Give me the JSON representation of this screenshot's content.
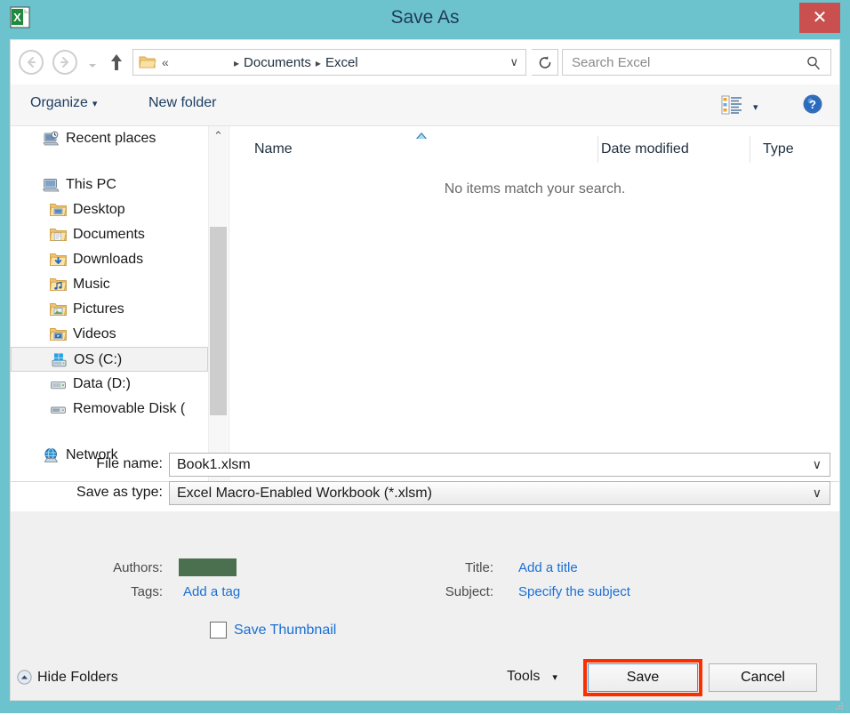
{
  "window": {
    "title": "Save As",
    "app_icon": "excel-icon",
    "close_label": "✕",
    "accent_color": "#6cc3ce",
    "close_color": "#c9504f"
  },
  "navbar": {
    "back_icon": "back-arrow-icon",
    "forward_icon": "forward-arrow-icon",
    "history_icon": "history-dropdown-icon",
    "up_icon": "up-arrow-icon",
    "folder_icon": "folder-icon",
    "overflow": "«",
    "breadcrumb": [
      "Documents",
      "Excel"
    ],
    "breadcrumb_separator": "▸",
    "dropdown_caret": "∨",
    "refresh_icon": "refresh-icon",
    "search_placeholder": "Search Excel",
    "search_value": "",
    "search_icon": "search-icon"
  },
  "toolbar": {
    "organize_label": "Organize",
    "organize_caret": "▾",
    "new_folder_label": "New folder",
    "view_icon": "list-view-icon",
    "view_caret": "▾",
    "help_icon": "help-icon"
  },
  "sidebar": {
    "items": [
      {
        "label": "Recent places",
        "icon": "recent-places-icon",
        "depth": 0,
        "selected": false
      },
      {
        "label": "This PC",
        "icon": "this-pc-icon",
        "depth": 0,
        "selected": false
      },
      {
        "label": "Desktop",
        "icon": "desktop-folder-icon",
        "depth": 1,
        "selected": false
      },
      {
        "label": "Documents",
        "icon": "documents-folder-icon",
        "depth": 1,
        "selected": false
      },
      {
        "label": "Downloads",
        "icon": "downloads-folder-icon",
        "depth": 1,
        "selected": false
      },
      {
        "label": "Music",
        "icon": "music-folder-icon",
        "depth": 1,
        "selected": false
      },
      {
        "label": "Pictures",
        "icon": "pictures-folder-icon",
        "depth": 1,
        "selected": false
      },
      {
        "label": "Videos",
        "icon": "videos-folder-icon",
        "depth": 1,
        "selected": false
      },
      {
        "label": "OS (C:)",
        "icon": "os-drive-icon",
        "depth": 1,
        "selected": true
      },
      {
        "label": "Data (D:)",
        "icon": "drive-icon",
        "depth": 1,
        "selected": false
      },
      {
        "label": "Removable Disk (",
        "icon": "removable-disk-icon",
        "depth": 1,
        "selected": false
      },
      {
        "label": "Network",
        "icon": "network-icon",
        "depth": 0,
        "selected": false
      }
    ],
    "scroll_up": "⌃",
    "scroll_down": "⌄"
  },
  "filelist": {
    "columns": [
      "Name",
      "Date modified",
      "Type"
    ],
    "sort_indicator": "ascending",
    "rows": [],
    "empty_message": "No items match your search.",
    "hscroll_left": "‹",
    "hscroll_right": "›"
  },
  "form": {
    "file_name_label": "File name:",
    "file_name_value": "Book1.xlsm",
    "save_as_type_label": "Save as type:",
    "save_as_type_value": "Excel Macro-Enabled Workbook (*.xlsm)",
    "combo_caret": "∨"
  },
  "metadata": {
    "authors_label": "Authors:",
    "authors_value": "",
    "authors_redacted_color": "#4a7050",
    "tags_label": "Tags:",
    "tags_value": "Add a tag",
    "title_label": "Title:",
    "title_value": "Add a title",
    "subject_label": "Subject:",
    "subject_value": "Specify the subject",
    "link_color": "#1a6fd4",
    "save_thumbnail_label": "Save Thumbnail",
    "save_thumbnail_checked": false
  },
  "footer": {
    "hide_folders_label": "Hide Folders",
    "hide_folders_icon": "collapse-up-icon",
    "tools_label": "Tools",
    "tools_caret": "▾",
    "save_label": "Save",
    "cancel_label": "Cancel",
    "highlight_color": "#fb2e00",
    "resize_grip_icon": "resize-grip-icon"
  }
}
